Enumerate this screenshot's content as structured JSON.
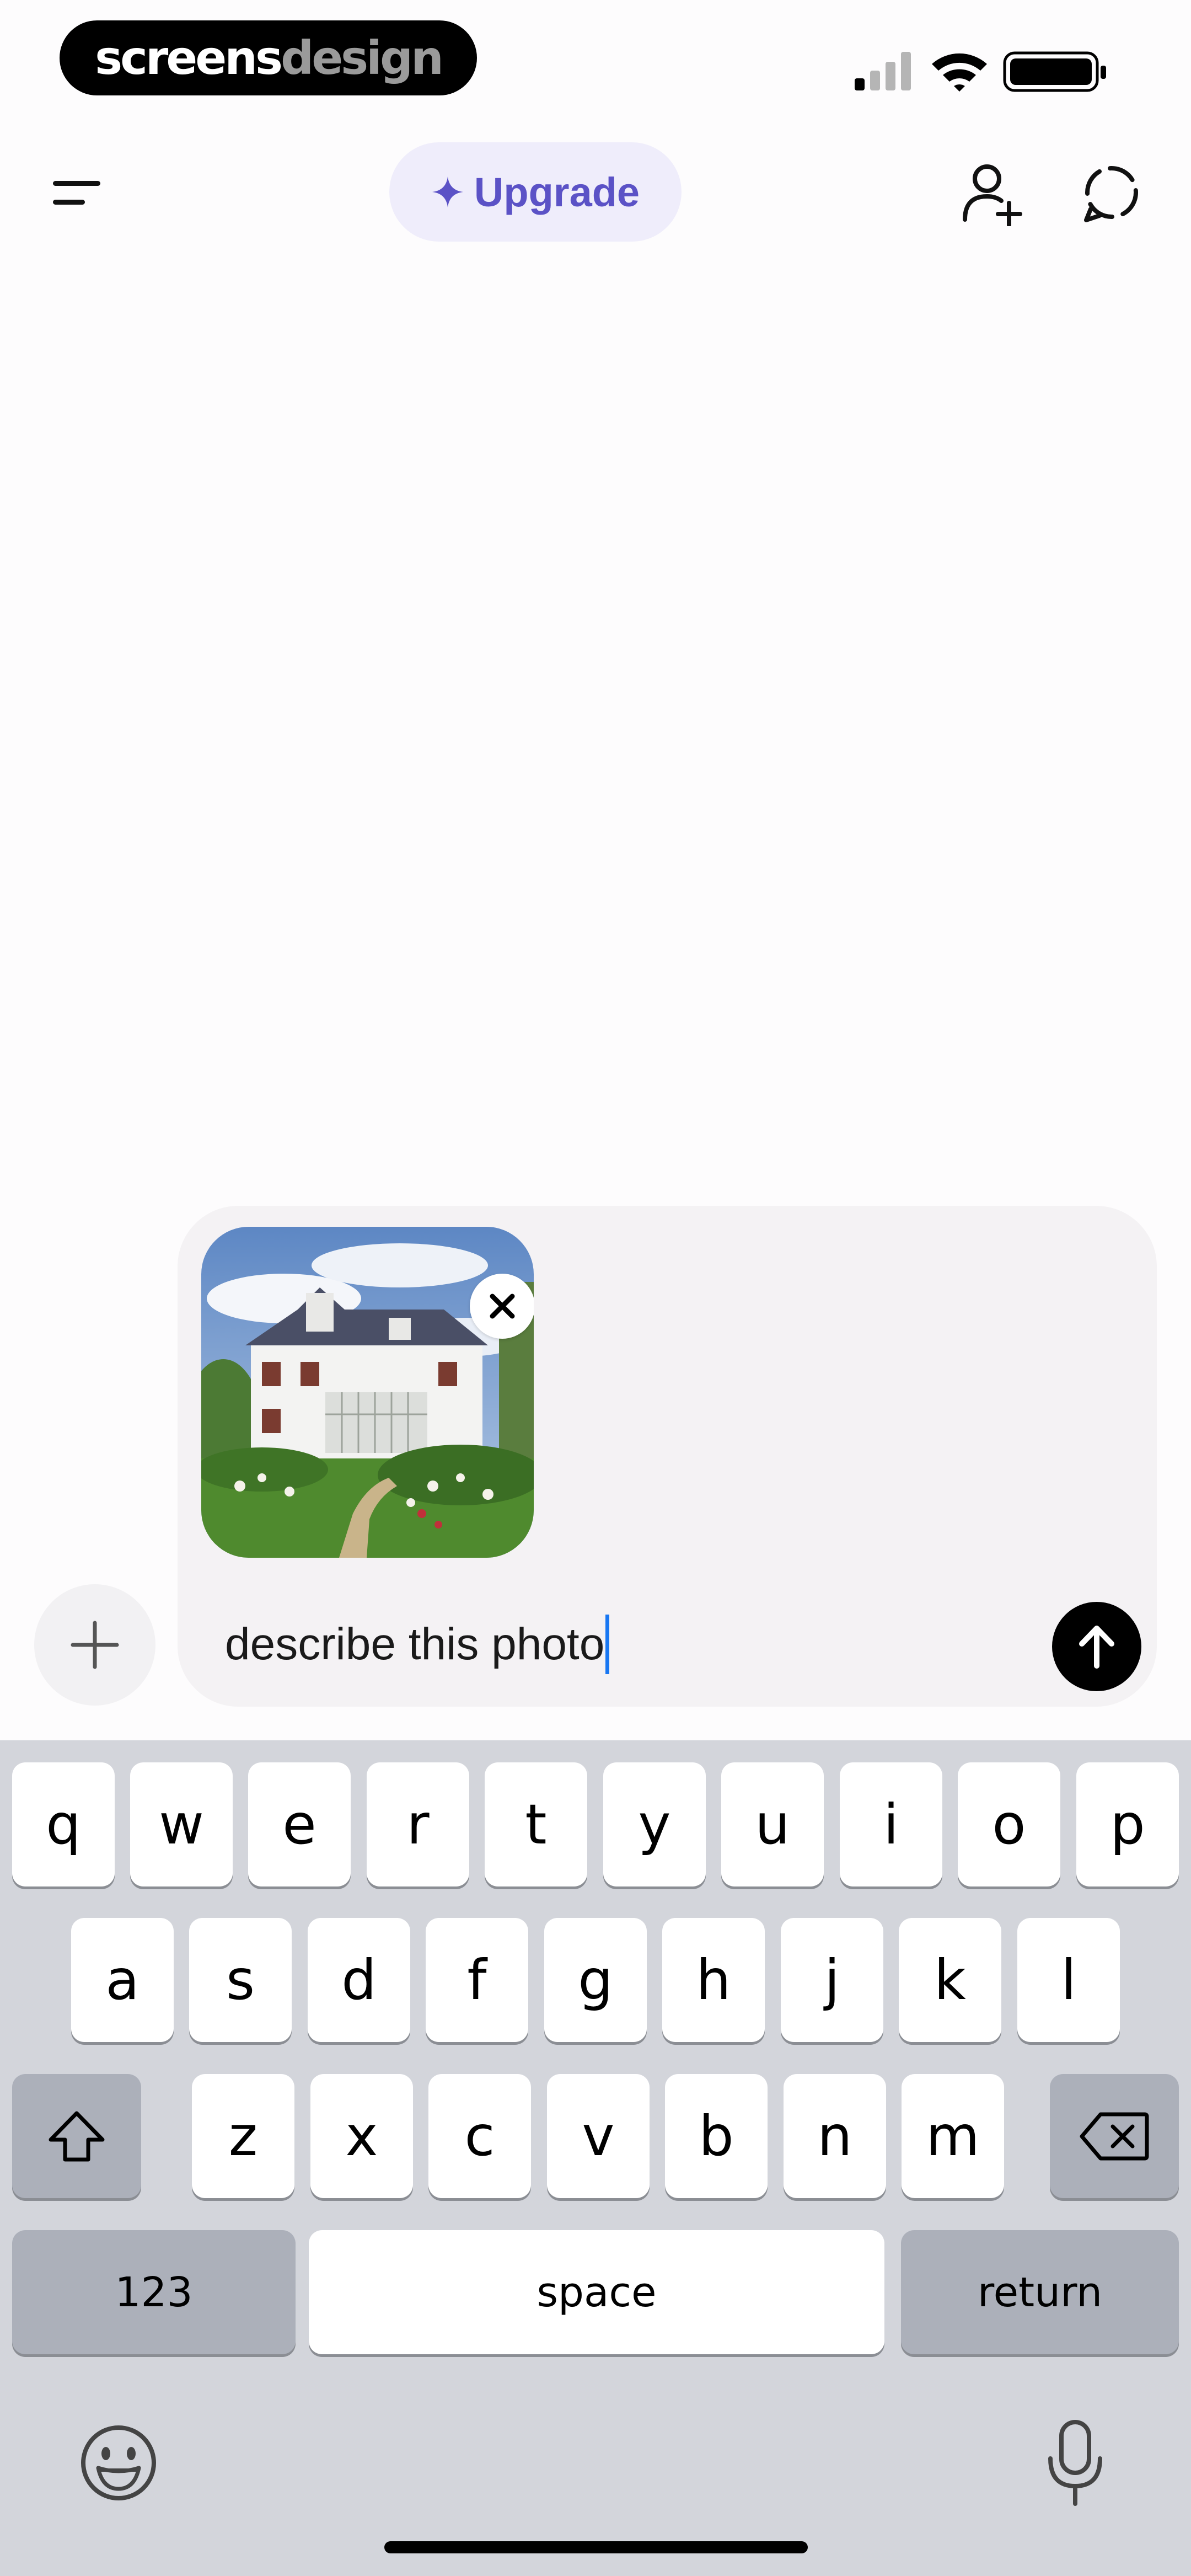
{
  "status_bar": {
    "brand": {
      "part1": "screens",
      "part2": "design"
    },
    "icons": [
      "cellular-signal-icon",
      "wifi-icon",
      "battery-icon"
    ]
  },
  "nav": {
    "menu_icon": "hamburger-menu-icon",
    "upgrade_label": "Upgrade",
    "upgrade_icon": "sparkle-icon",
    "add_user_icon": "add-user-icon",
    "new_chat_icon": "new-chat-icon",
    "accent_color": "#5b52c6",
    "pill_color": "#efedfb"
  },
  "composer": {
    "attachment_icon": "photo-thumbnail",
    "remove_icon": "close-icon",
    "message_value": "describe this photo",
    "send_icon": "arrow-up-icon",
    "add_icon": "plus-icon",
    "caret_color": "#1877f2"
  },
  "keyboard": {
    "row1": [
      "q",
      "w",
      "e",
      "r",
      "t",
      "y",
      "u",
      "i",
      "o",
      "p"
    ],
    "row2": [
      "a",
      "s",
      "d",
      "f",
      "g",
      "h",
      "j",
      "k",
      "l"
    ],
    "row3": [
      "z",
      "x",
      "c",
      "v",
      "b",
      "n",
      "m"
    ],
    "numbers_label": "123",
    "space_label": "space",
    "return_label": "return",
    "shift_icon": "shift-icon",
    "delete_icon": "backspace-icon",
    "emoji_icon": "emoji-icon",
    "mic_icon": "microphone-icon"
  }
}
